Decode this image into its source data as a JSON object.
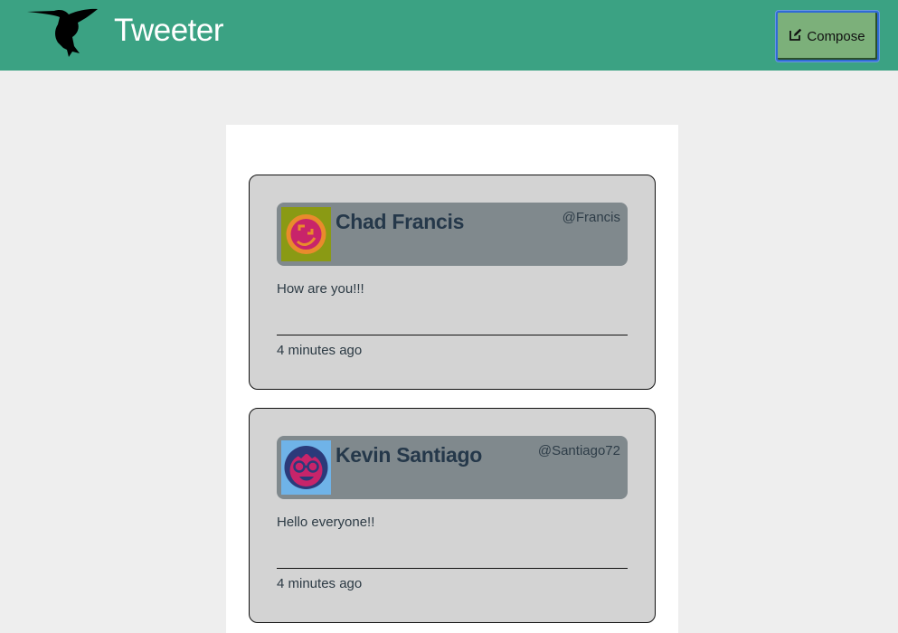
{
  "navbar": {
    "brand": "Tweeter",
    "logo_icon": "hummingbird-icon",
    "compose_label": "Compose",
    "compose_icon": "edit-icon",
    "bg_color": "#3ba283"
  },
  "tweets": [
    {
      "name": "Chad Francis",
      "handle": "@Francis",
      "content": "How are you!!!",
      "time": "4 minutes ago",
      "avatar_icon": "smiley-avatar-icon"
    },
    {
      "name": "Kevin Santiago",
      "handle": "@Santiago72",
      "content": "Hello everyone!!",
      "time": "4 minutes ago",
      "avatar_icon": "glasses-face-avatar-icon"
    }
  ]
}
